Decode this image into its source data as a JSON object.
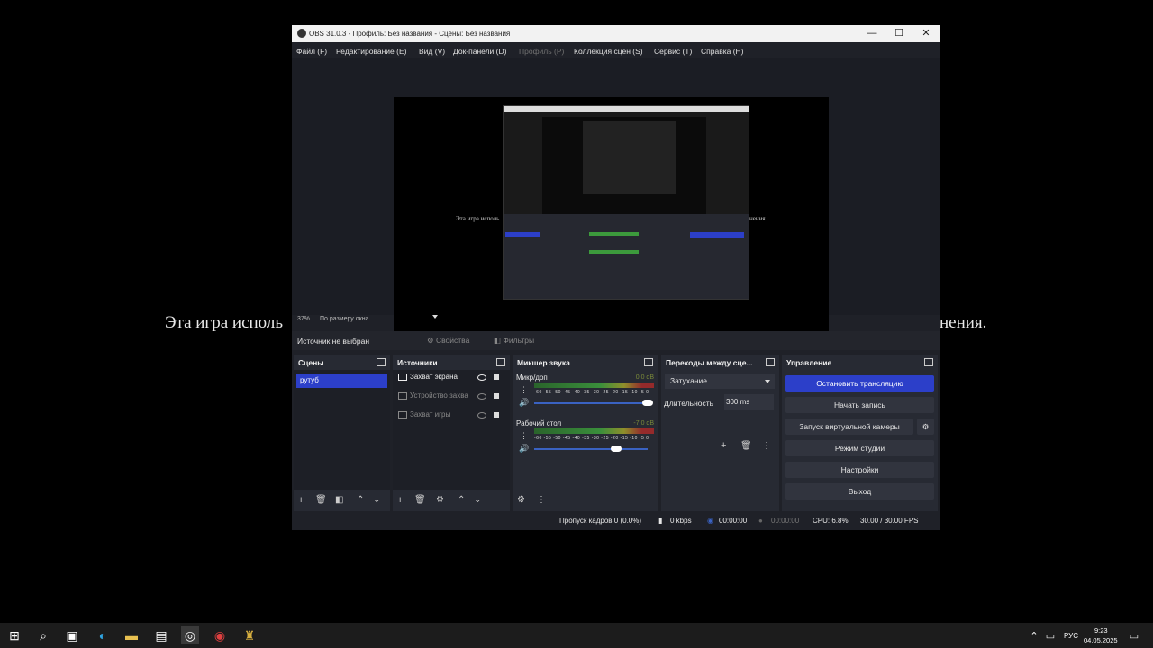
{
  "background": {
    "text_left": "Эта игра исполь",
    "text_right": "нения."
  },
  "window": {
    "title": "OBS 31.0.3 - Профиль: Без названия - Сцены: Без названия",
    "controls": {
      "minimize": "—",
      "maximize": "☐",
      "close": "✕"
    }
  },
  "menu": [
    {
      "label": "Файл (F)",
      "enabled": true
    },
    {
      "label": "Редактирование (E)",
      "enabled": true
    },
    {
      "label": "Вид (V)",
      "enabled": true
    },
    {
      "label": "Док-панели (D)",
      "enabled": true
    },
    {
      "label": "Профиль (P)",
      "enabled": false
    },
    {
      "label": "Коллекция сцен (S)",
      "enabled": true
    },
    {
      "label": "Сервис (T)",
      "enabled": true
    },
    {
      "label": "Справка (H)",
      "enabled": true
    }
  ],
  "preview": {
    "text_left": "Эта игра исполь",
    "text_right": "нения.",
    "zoom": "37%",
    "zoom_mode": "По размеру окна"
  },
  "source_toolbar": {
    "no_source": "Источник не выбран",
    "properties": "Свойства",
    "filters": "Фильтры"
  },
  "scenes": {
    "title": "Сцены",
    "items": [
      "рутуб"
    ]
  },
  "sources": {
    "title": "Источники",
    "items": [
      {
        "name": "Захват экрана",
        "visible": true
      },
      {
        "name": "Устройство захва",
        "visible": false
      },
      {
        "name": "Захват игры",
        "visible": false
      }
    ]
  },
  "mixer": {
    "title": "Микшер звука",
    "scale": "-60 -55 -50 -45 -40 -35 -30 -25 -20 -15 -10 -5 0",
    "channels": [
      {
        "name": "Микр/доп",
        "db": "0.0 dB",
        "volume": 1.0
      },
      {
        "name": "Рабочий стол",
        "db": "-7.0 dB",
        "volume": 0.72
      }
    ]
  },
  "transitions": {
    "title": "Переходы между сце...",
    "selected": "Затухание",
    "duration_label": "Длительность",
    "duration_value": "300 ms"
  },
  "controls": {
    "title": "Управление",
    "stop_stream": "Остановить трансляцию",
    "start_record": "Начать запись",
    "virtual_cam": "Запуск виртуальной камеры",
    "studio_mode": "Режим студии",
    "settings": "Настройки",
    "exit": "Выход"
  },
  "status": {
    "dropped": "Пропуск кадров 0 (0.0%)",
    "bitrate": "0 kbps",
    "stream_time": "00:00:00",
    "rec_time": "00:00:00",
    "cpu": "CPU: 6.8%",
    "fps": "30.00 / 30.00 FPS"
  },
  "taskbar": {
    "lang": "РУС",
    "time": "9:23",
    "date": "04.05.2025"
  },
  "colors": {
    "accent": "#2c3fc9",
    "window_bg": "#1f2128",
    "dock_bg": "#272a33"
  }
}
